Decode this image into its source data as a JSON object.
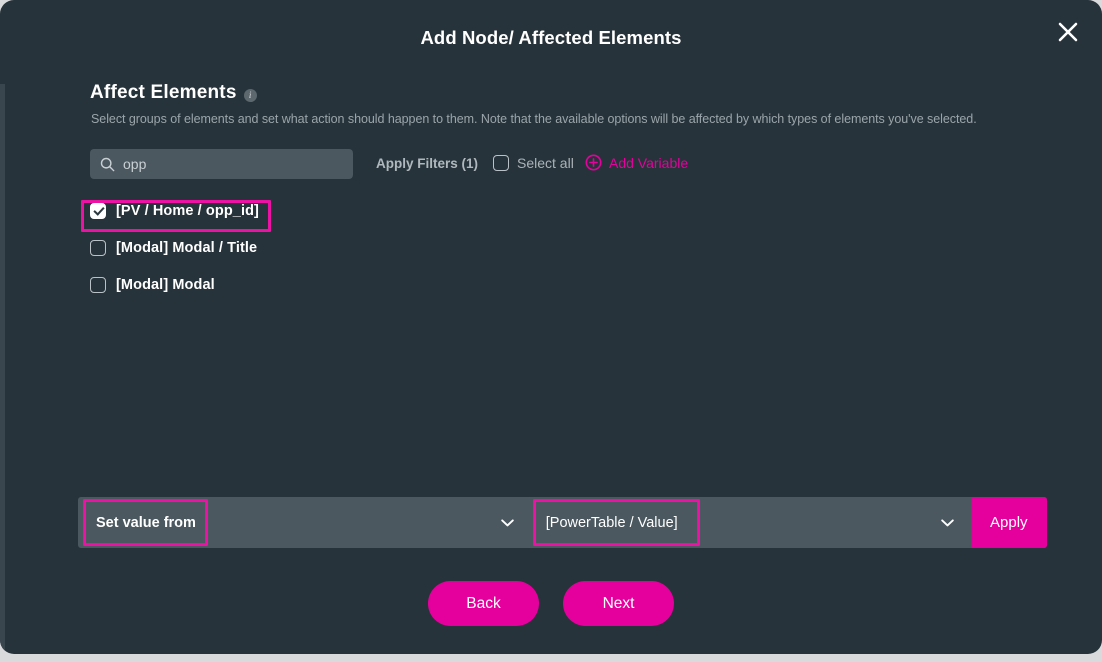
{
  "modal": {
    "title": "Add Node/ Affected Elements",
    "close_icon": "close-icon"
  },
  "section": {
    "heading": "Affect Elements",
    "info_icon": "info-icon",
    "description": "Select groups of elements and set what action should happen to them. Note that the available options will be affected by which types of elements you've selected."
  },
  "controls": {
    "search": {
      "value": "opp",
      "placeholder": "Search",
      "icon": "search-icon"
    },
    "apply_filters_label": "Apply Filters (1)",
    "select_all_label": "Select all",
    "select_all_checked": false,
    "add_variable_label": "Add Variable",
    "add_variable_icon": "plus-circle-icon"
  },
  "elements": [
    {
      "label": "[PV / Home / opp_id]",
      "checked": true
    },
    {
      "label": "[Modal] Modal / Title",
      "checked": false
    },
    {
      "label": "[Modal] Modal",
      "checked": false
    }
  ],
  "action_bar": {
    "field_label": "Set value from",
    "action_dropdown_value": "",
    "source_dropdown_value": "[PowerTable / Value]",
    "chevron_icon": "chevron-down-icon",
    "apply_label": "Apply"
  },
  "nav": {
    "back_label": "Back",
    "next_label": "Next"
  },
  "colors": {
    "accent": "#e5009e",
    "annotation": "#ec13a4",
    "modal_bg": "#27333a",
    "field_bg": "#4b585f",
    "page_bg": "#d8dadc"
  }
}
